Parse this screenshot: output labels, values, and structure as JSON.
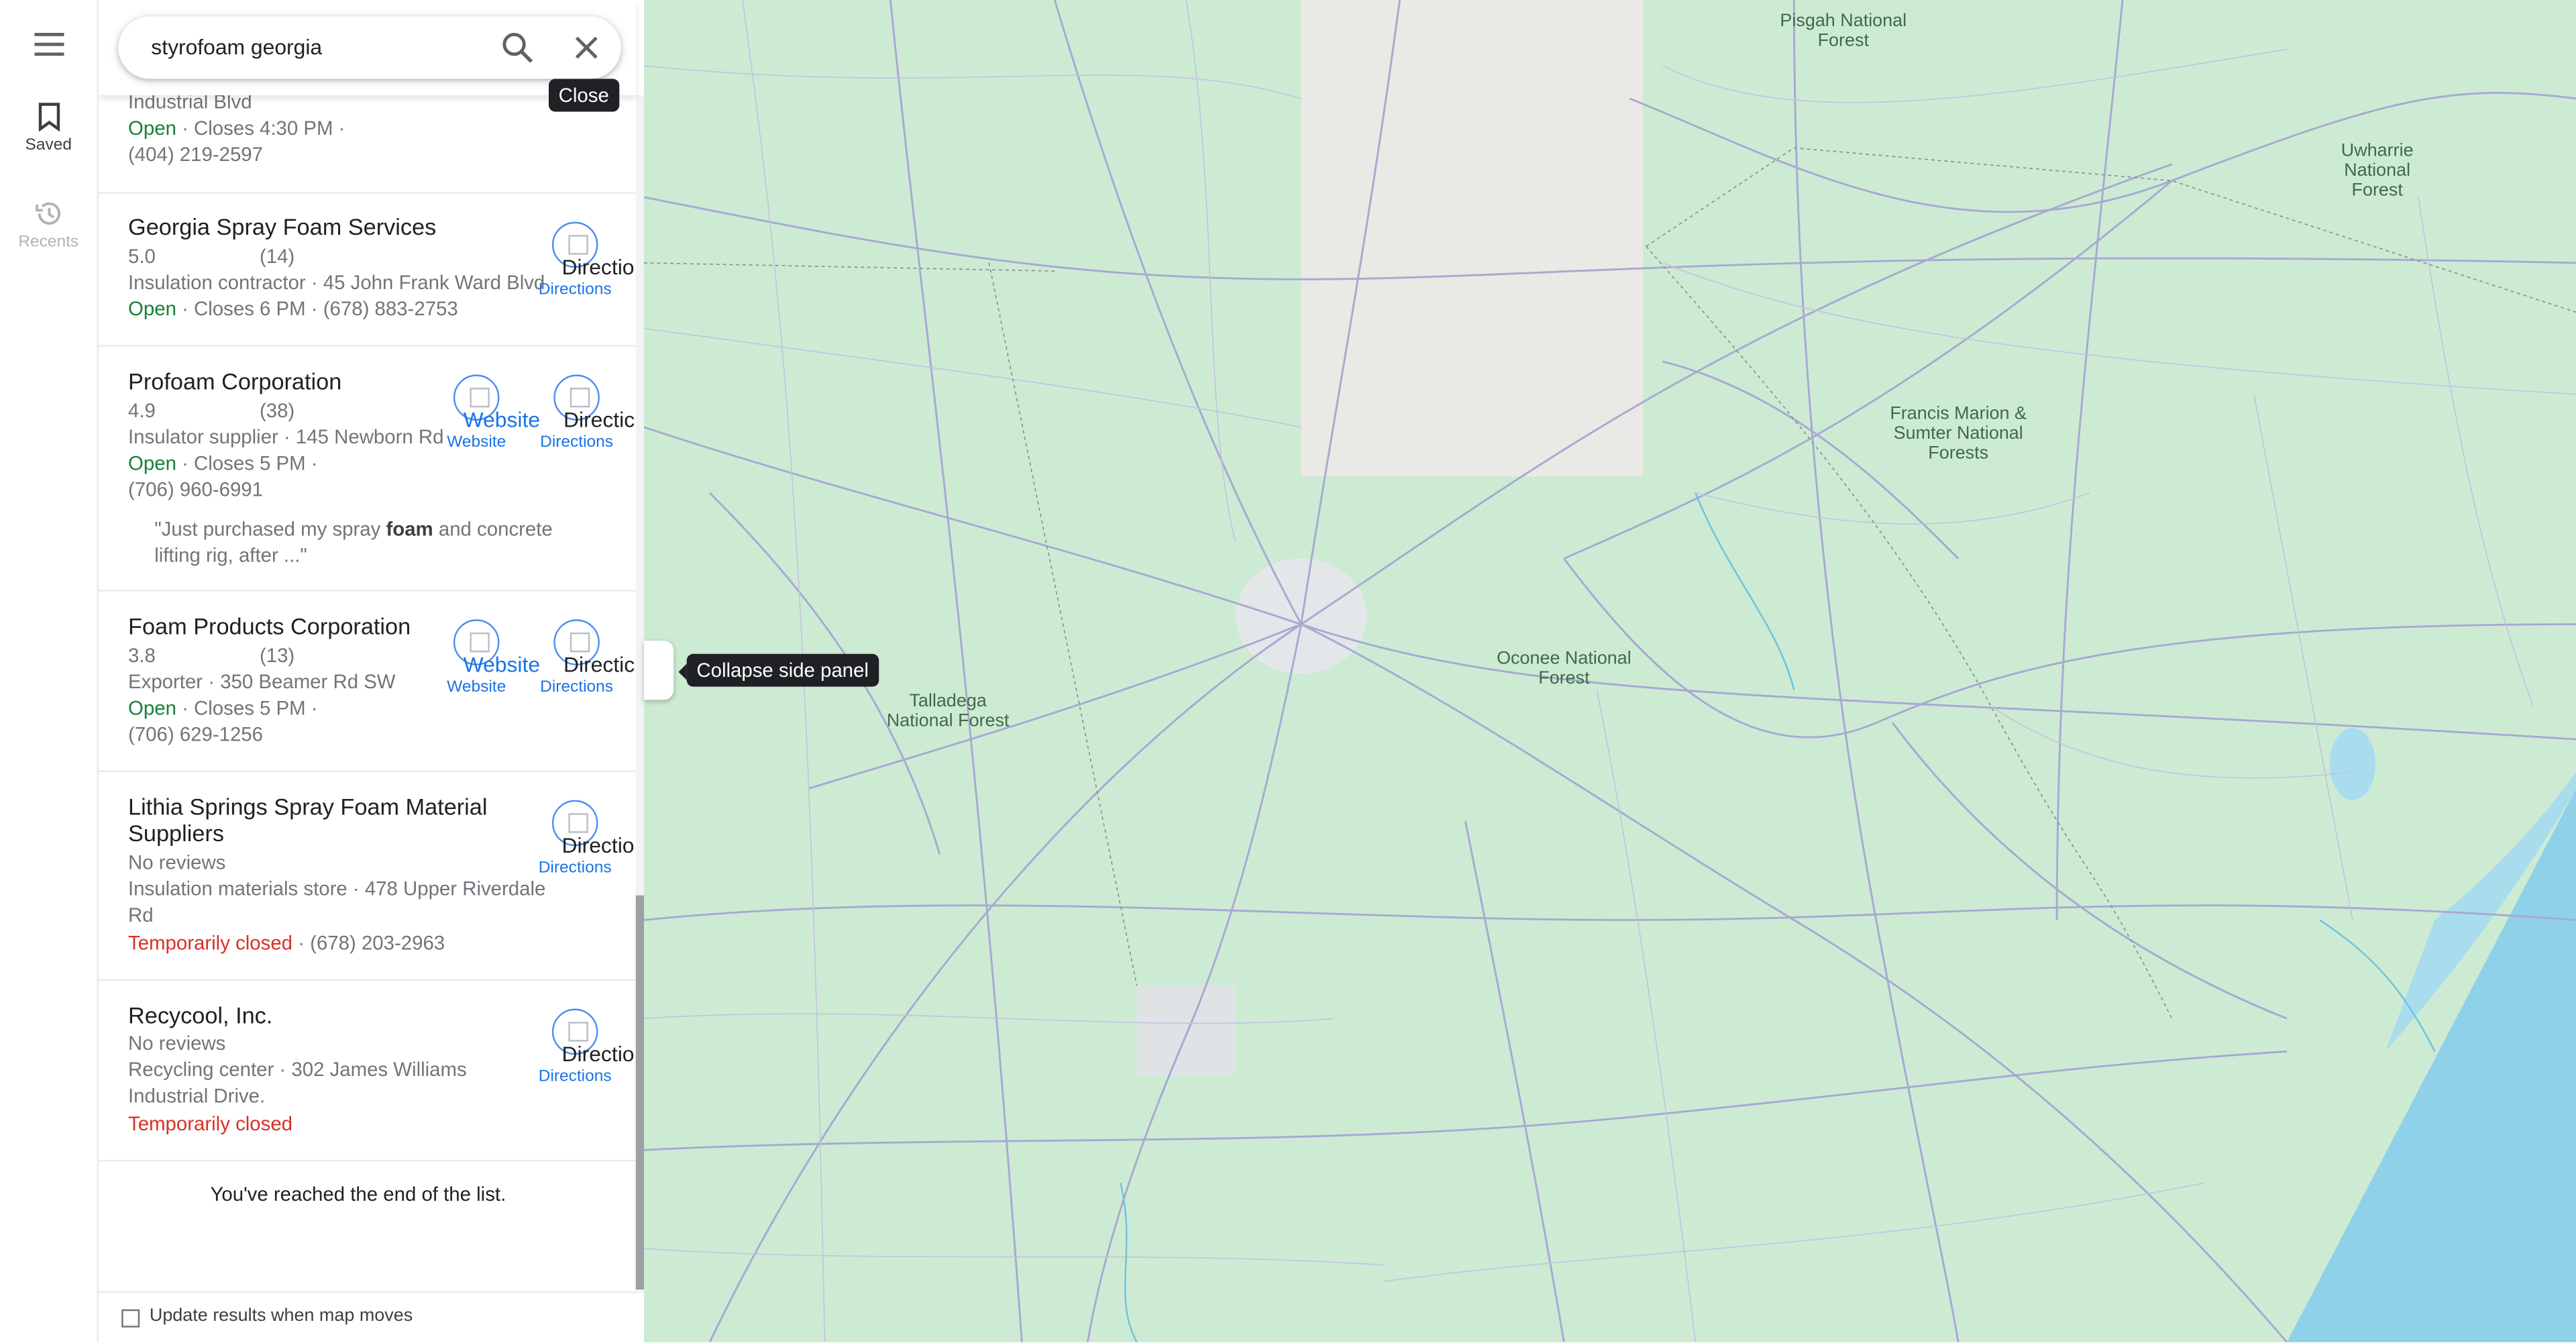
{
  "rail": {
    "saved_label": "Saved",
    "recents_label": "Recents"
  },
  "search": {
    "query": "styrofoam georgia",
    "close_tooltip": "Close"
  },
  "partial_result": {
    "address": "Industrial Blvd",
    "status": "Open",
    "hours": "Closes 4:30 PM ·",
    "phone": "(404) 219-2597"
  },
  "results": [
    {
      "name": "Georgia Spray Foam Services",
      "rating": "5.0",
      "reviews": "(14)",
      "category_address": "Insulation contractor · 45 John Frank Ward Blvd",
      "status": "Open",
      "hours_phone": "Closes 6 PM · (678) 883-2753",
      "directions_big": "Directio",
      "directions": "Directions"
    },
    {
      "name": "Profoam Corporation",
      "rating": "4.9",
      "reviews": "(38)",
      "category_address": "Insulator supplier · 145 Newborn Rd",
      "status": "Open",
      "hours": "Closes 5 PM ·",
      "phone": "(706) 960-6991",
      "quote_pre": "\"Just purchased my spray ",
      "quote_bold": "foam",
      "quote_post": " and concrete lifting rig, after ...\"",
      "website_big": "Website",
      "website": "Website",
      "directions_big": "Directic",
      "directions": "Directions"
    },
    {
      "name": "Foam Products Corporation",
      "rating": "3.8",
      "reviews": "(13)",
      "category_address": "Exporter · 350 Beamer Rd SW",
      "status": "Open",
      "hours": "Closes 5 PM ·",
      "phone": "(706) 629-1256",
      "website_big": "Website",
      "website": "Website",
      "directions_big": "Directic",
      "directions": "Directions"
    },
    {
      "name": "Lithia Springs Spray Foam Material Suppliers",
      "reviews_text": "No reviews",
      "category_address": "Insulation materials store · 478 Upper Riverdale",
      "address_cont": "Rd",
      "status": "Temporarily closed",
      "phone": "· (678) 203-2963",
      "directions_big": "Directio",
      "directions": "Directions"
    },
    {
      "name": "Recycool, Inc.",
      "reviews_text": "No reviews",
      "category_address": "Recycling center · 302 James Williams",
      "address_cont": "Industrial Drive.",
      "status": "Temporarily closed",
      "directions_big": "Directio",
      "directions": "Directions"
    }
  ],
  "end_of_list": "You've reached the end of the list.",
  "update_results_label": "Update results when map moves",
  "collapse_tooltip": "Collapse side panel",
  "map_labels": {
    "pisgah": "Pisgah National Forest",
    "uwharrie": "Uwharrie National Forest",
    "francis": "Francis Marion & Sumter National Forests",
    "oconee": "Oconee National Forest",
    "talladega": "Talladega National Forest"
  },
  "colors": {
    "accent": "#1a73e8",
    "open": "#188038",
    "closed": "#d93025",
    "map_green": "#cdebd3",
    "water": "#8fd1e8"
  }
}
